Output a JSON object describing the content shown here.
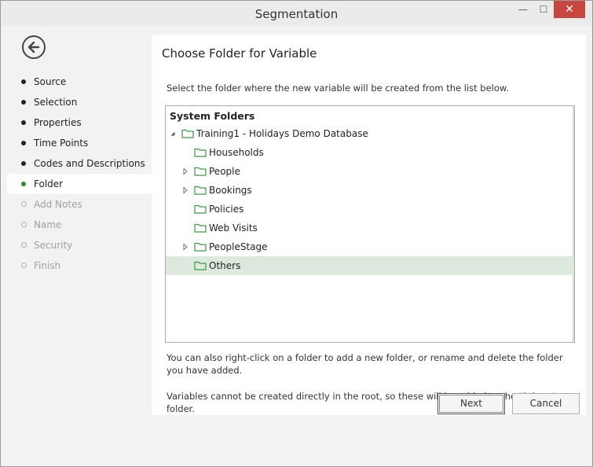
{
  "window": {
    "title": "Segmentation",
    "controls": {
      "minimize": "—",
      "maximize": "☐",
      "close": "✕"
    }
  },
  "sidebar": {
    "back_icon": "back-arrow-icon",
    "steps": [
      {
        "label": "Source",
        "state": "done"
      },
      {
        "label": "Selection",
        "state": "done"
      },
      {
        "label": "Properties",
        "state": "done"
      },
      {
        "label": "Time Points",
        "state": "done"
      },
      {
        "label": "Codes and Descriptions",
        "state": "done"
      },
      {
        "label": "Folder",
        "state": "active"
      },
      {
        "label": "Add Notes",
        "state": "disabled"
      },
      {
        "label": "Name",
        "state": "disabled"
      },
      {
        "label": "Security",
        "state": "disabled"
      },
      {
        "label": "Finish",
        "state": "disabled"
      }
    ]
  },
  "main": {
    "heading": "Choose Folder for Variable",
    "instructions": "Select the folder where the new variable will be created from the list below.",
    "tree": {
      "header": "System Folders",
      "items": [
        {
          "label": "Training1 - Holidays Demo Database",
          "expander": "expanded"
        },
        {
          "label": "Households",
          "expander": "none"
        },
        {
          "label": "People",
          "expander": "collapsed"
        },
        {
          "label": "Bookings",
          "expander": "collapsed"
        },
        {
          "label": "Policies",
          "expander": "none"
        },
        {
          "label": "Web Visits",
          "expander": "none"
        },
        {
          "label": "PeopleStage",
          "expander": "collapsed"
        },
        {
          "label": "Others",
          "expander": "none",
          "selected": true
        }
      ]
    },
    "note1": "You can also right-click on a folder to add a new folder, or rename and delete the folder you have added.",
    "note2": "Variables cannot be created directly in the root, so these will be added to the 'Others' folder."
  },
  "footer": {
    "next_label": "Next",
    "cancel_label": "Cancel"
  },
  "colors": {
    "accent_green": "#2f8a3a",
    "selection_bg": "#dde9dd",
    "close_red": "#c7463d",
    "folder_green": "#3a9a44"
  }
}
